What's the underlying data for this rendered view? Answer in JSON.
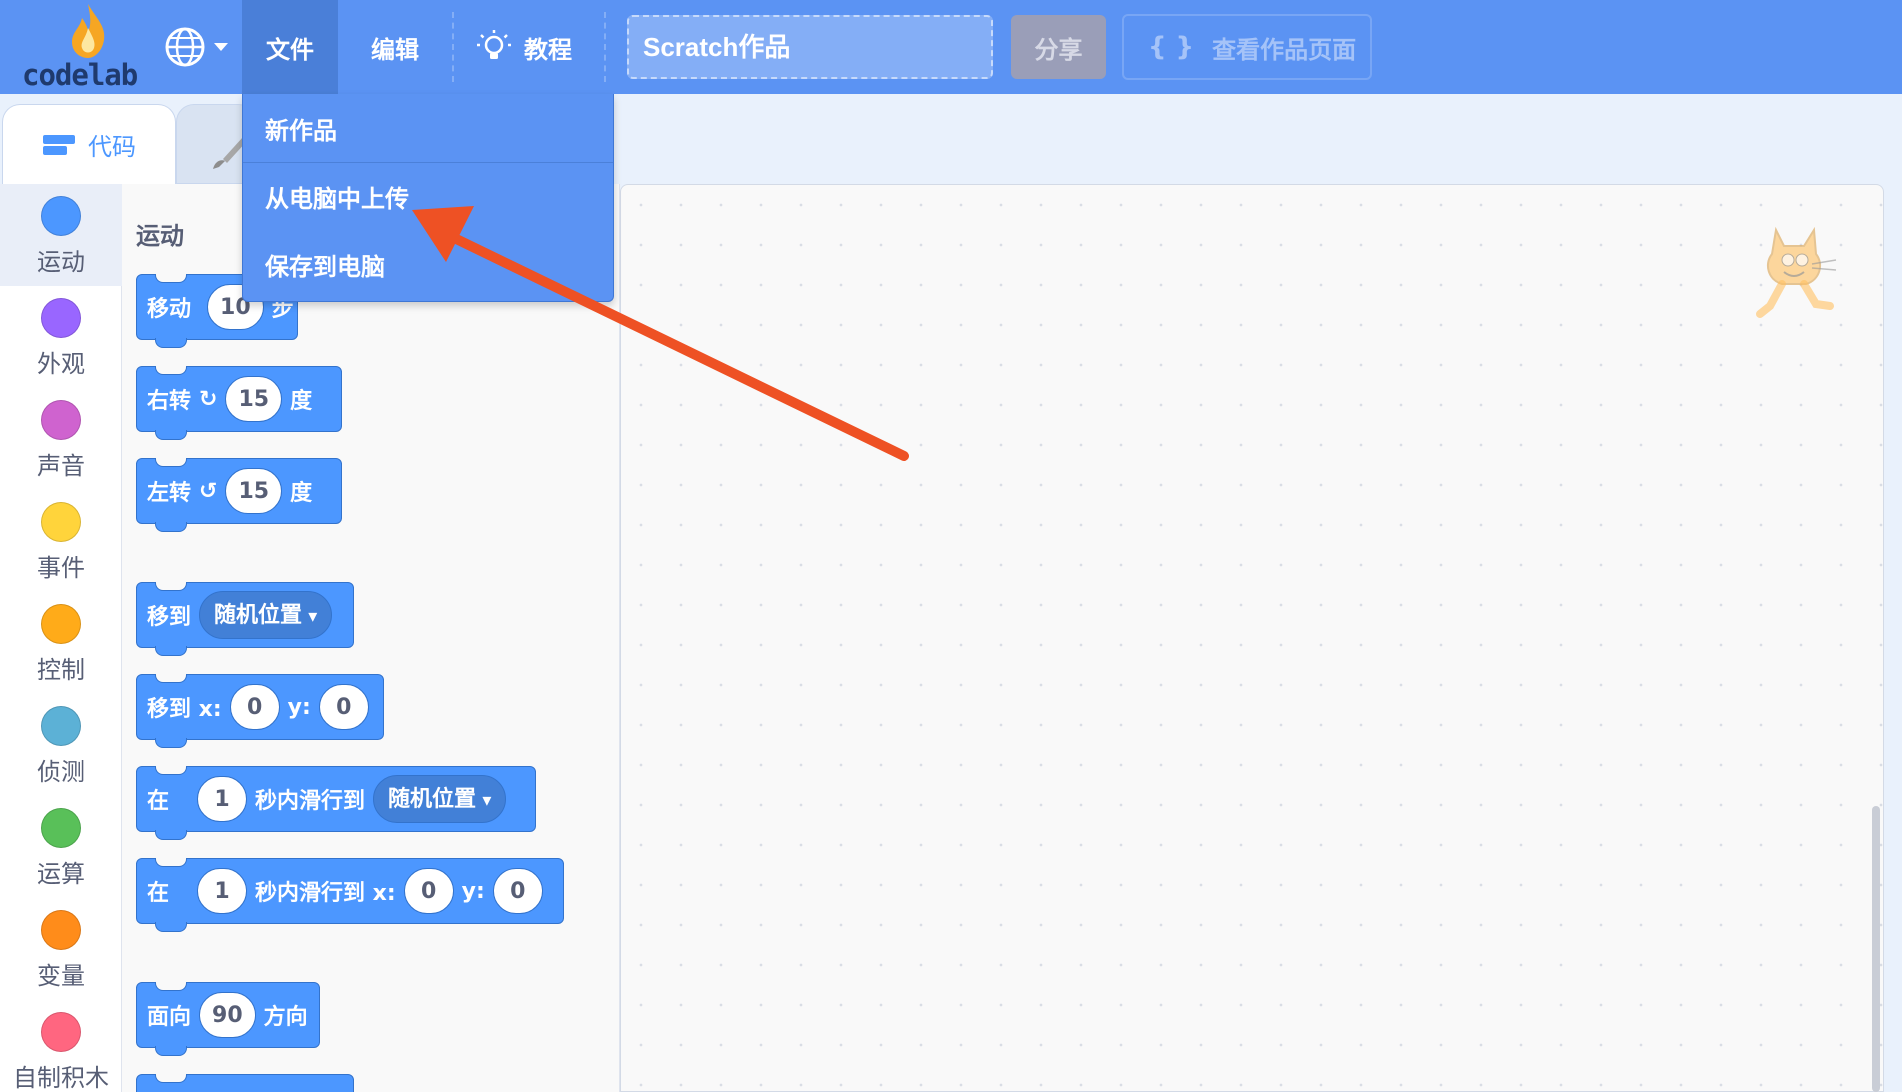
{
  "logo": {
    "text": "codelab"
  },
  "menubar": {
    "language_icon": "globe-icon",
    "file": "文件",
    "edit": "编辑",
    "tutorials": "教程",
    "project_title": "Scratch作品",
    "share": "分享",
    "view_project_page": "查看作品页面"
  },
  "file_menu": {
    "items": [
      "新作品",
      "从电脑中上传",
      "保存到电脑"
    ]
  },
  "tabs": {
    "code": "代码"
  },
  "categories": [
    {
      "label": "运动",
      "color": "#4c97ff"
    },
    {
      "label": "外观",
      "color": "#9966ff"
    },
    {
      "label": "声音",
      "color": "#cf63cf"
    },
    {
      "label": "事件",
      "color": "#ffd43b"
    },
    {
      "label": "控制",
      "color": "#ffab19"
    },
    {
      "label": "侦测",
      "color": "#5cb1d6"
    },
    {
      "label": "运算",
      "color": "#59c059"
    },
    {
      "label": "变量",
      "color": "#ff8c1a"
    },
    {
      "label": "自制积木",
      "color": "#ff6680"
    }
  ],
  "palette": {
    "title": "运动",
    "blocks": {
      "move": {
        "label": "移动",
        "value": "10",
        "unit": "步"
      },
      "turn_right": {
        "label": "右转",
        "value": "15",
        "unit": "度"
      },
      "turn_left": {
        "label": "左转",
        "value": "15",
        "unit": "度"
      },
      "goto": {
        "label": "移到",
        "target": "随机位置"
      },
      "goto_xy": {
        "label": "移到 x:",
        "x": "0",
        "y_label": "y:",
        "y": "0"
      },
      "glide_to": {
        "label": "在",
        "secs": "1",
        "mid": "秒内滑行到",
        "target": "随机位置"
      },
      "glide_xy": {
        "label": "在",
        "secs": "1",
        "mid": "秒内滑行到 x:",
        "x": "0",
        "y_label": "y:",
        "y": "0"
      },
      "point": {
        "label": "面向",
        "value": "90",
        "unit": "方向"
      }
    }
  },
  "annotation": {
    "color": "#ee5124"
  }
}
